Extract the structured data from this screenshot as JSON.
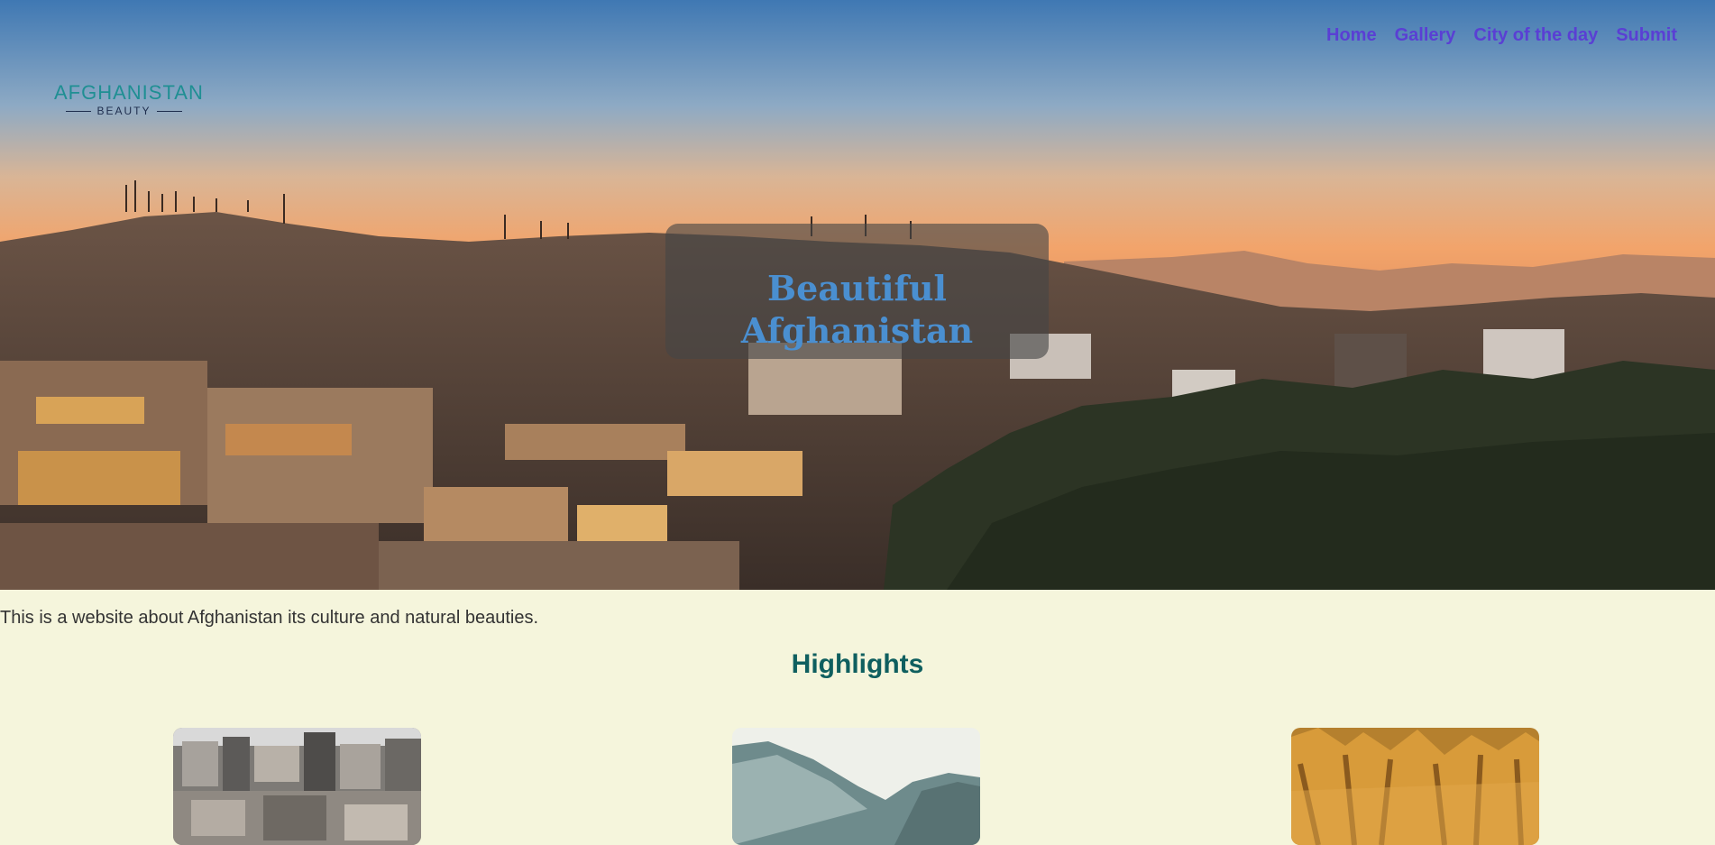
{
  "logo": {
    "main": "AFGHANISTAN",
    "sub": "BEAUTY"
  },
  "nav": {
    "items": [
      "Home",
      "Gallery",
      "City of the day",
      "Submit"
    ]
  },
  "hero": {
    "title": "Beautiful Afghanistan"
  },
  "intro_text": "This is a website about Afghanistan its culture and natural beauties.",
  "highlights": {
    "title": "Highlights",
    "cards": [
      {
        "image": "city-photo"
      },
      {
        "image": "snowy-valley-photo"
      },
      {
        "image": "rock-formations-photo"
      }
    ]
  },
  "colors": {
    "background": "#f5f5dc",
    "nav_link": "#5a3fd4",
    "hero_title": "#4a8fd0",
    "highlights_title": "#0f5f5f",
    "logo": "#1f8f93"
  }
}
